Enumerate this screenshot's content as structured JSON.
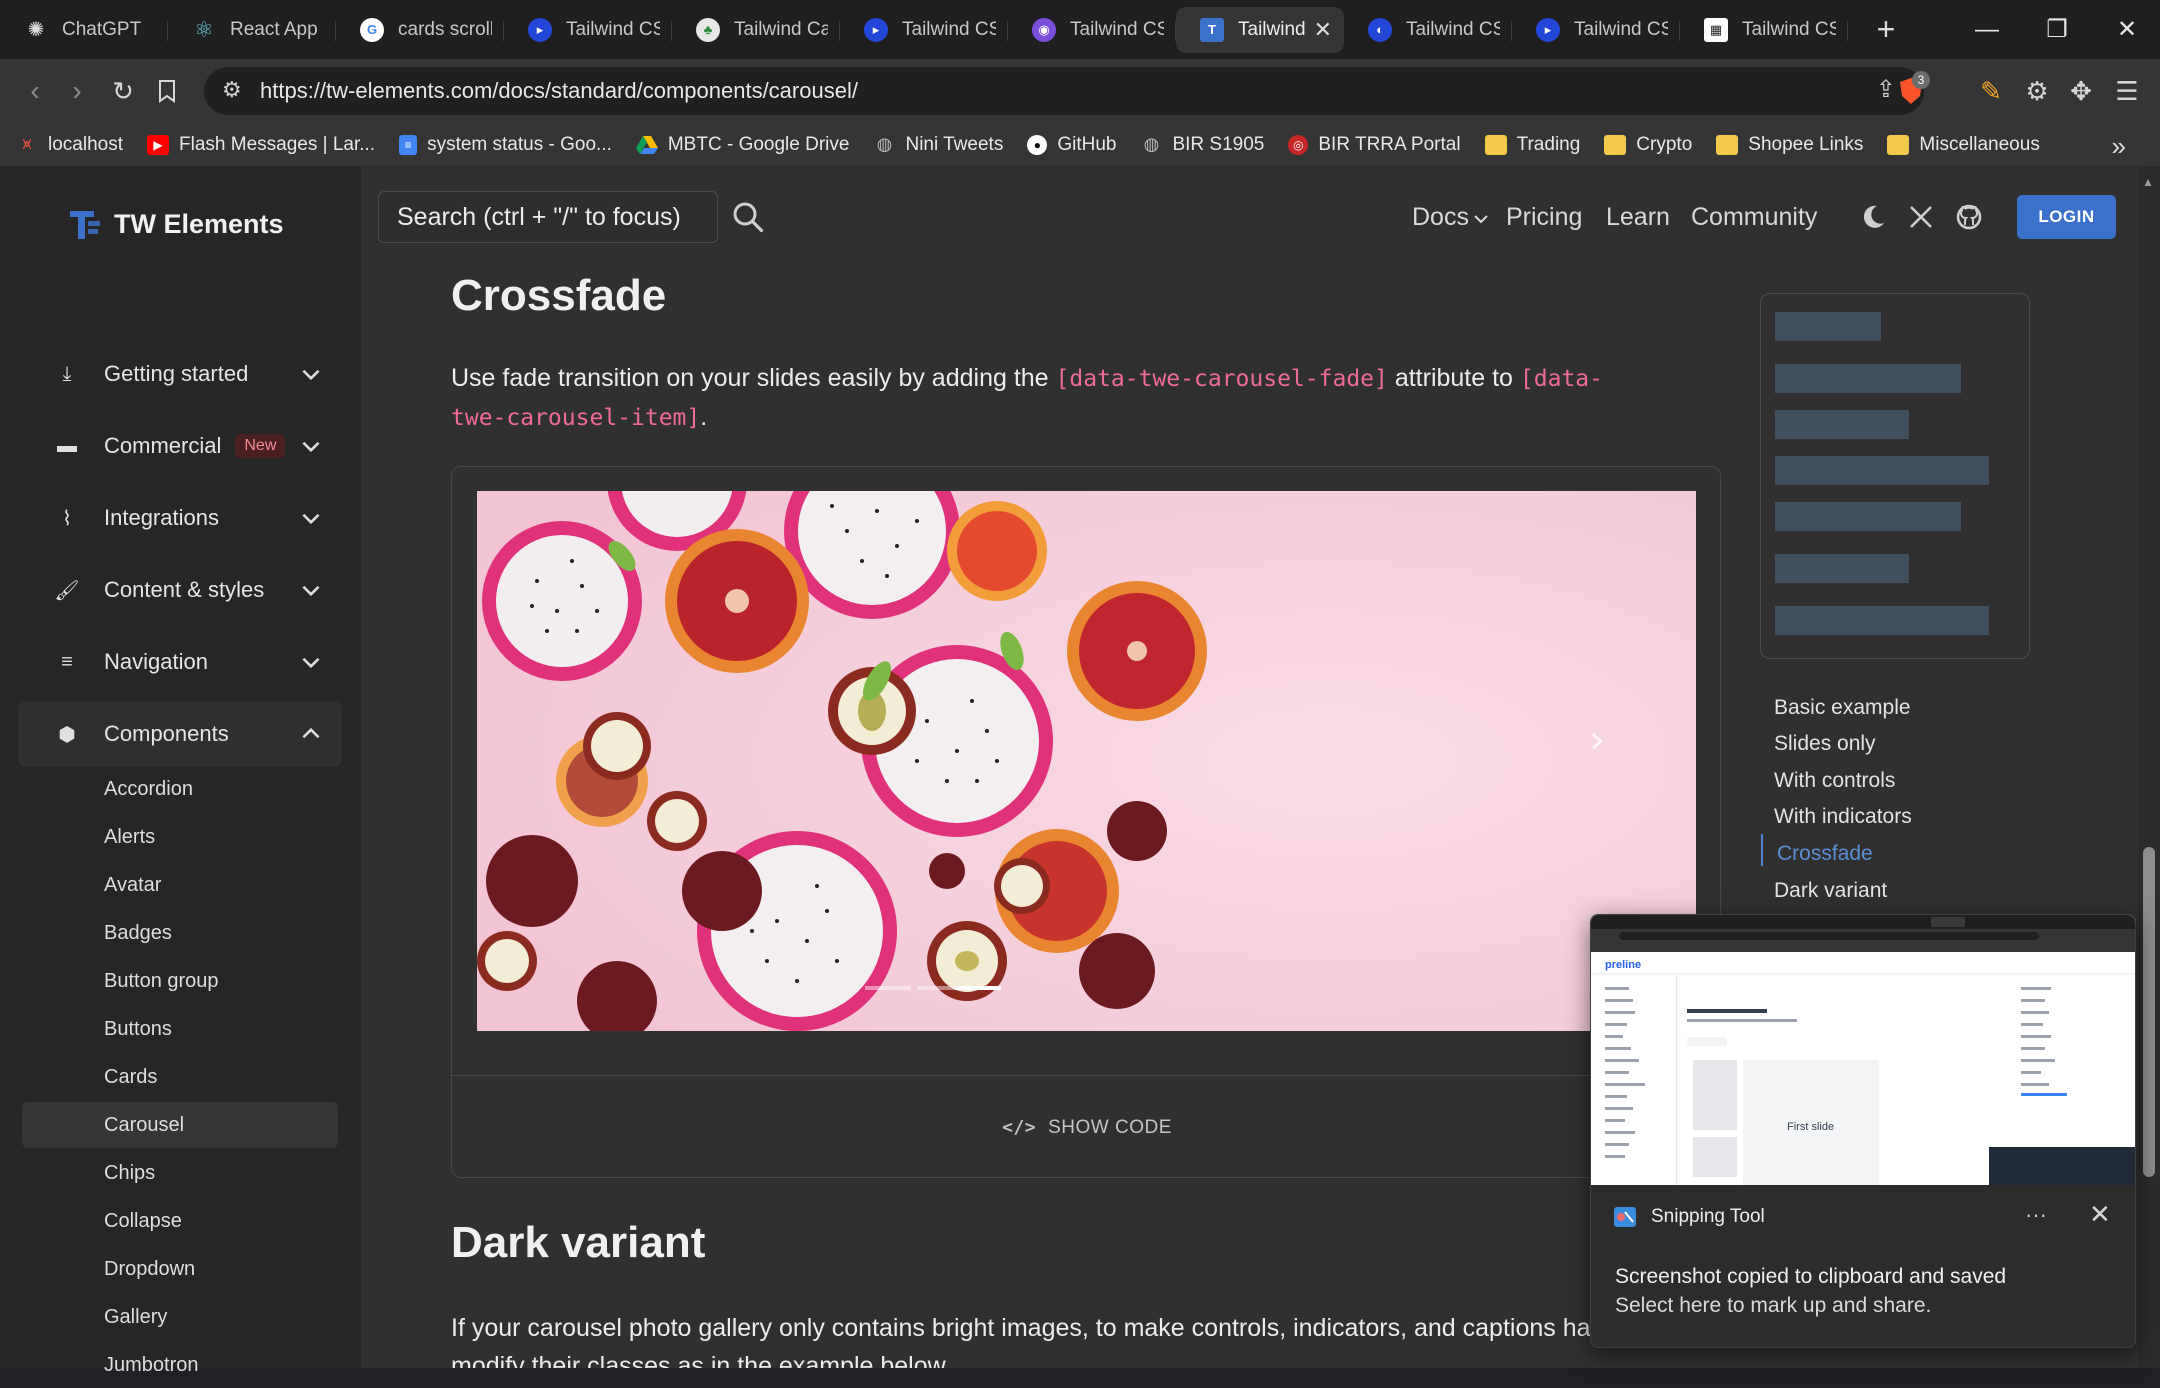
{
  "browser": {
    "tabs": [
      {
        "title": "ChatGPT",
        "icon": "chatgpt-icon"
      },
      {
        "title": "React App",
        "icon": "react-icon"
      },
      {
        "title": "cards scroll",
        "icon": "google-icon"
      },
      {
        "title": "Tailwind CS",
        "icon": "tailwind-icon"
      },
      {
        "title": "Tailwind Car",
        "icon": "leaf-icon"
      },
      {
        "title": "Tailwind CS",
        "icon": "tailwind-icon"
      },
      {
        "title": "Tailwind CS",
        "icon": "purple-icon"
      },
      {
        "title": "Tailwind",
        "icon": "tw-elements-icon",
        "active": true
      },
      {
        "title": "Tailwind CS",
        "icon": "tailwind-icon"
      },
      {
        "title": "Tailwind CS",
        "icon": "tailwind-icon"
      },
      {
        "title": "Tailwind CS",
        "icon": "grid-icon"
      }
    ],
    "new_tab_label": "+",
    "url": "https://tw-elements.com/docs/standard/components/carousel/",
    "shield_count": "3",
    "bookmarks": [
      {
        "label": "localhost",
        "icon": "laravel-icon"
      },
      {
        "label": "Flash Messages | Lar...",
        "icon": "youtube-icon"
      },
      {
        "label": "system status - Goo...",
        "icon": "docs-icon"
      },
      {
        "label": "MBTC - Google Drive",
        "icon": "drive-icon"
      },
      {
        "label": "Nini Tweets",
        "icon": "globe-icon"
      },
      {
        "label": "GitHub",
        "icon": "github-icon"
      },
      {
        "label": "BIR S1905",
        "icon": "globe-icon"
      },
      {
        "label": "BIR TRRA Portal",
        "icon": "bir-icon"
      },
      {
        "label": "Trading",
        "icon": "folder-icon"
      },
      {
        "label": "Crypto",
        "icon": "folder-icon"
      },
      {
        "label": "Shopee Links",
        "icon": "folder-icon"
      },
      {
        "label": "Miscellaneous",
        "icon": "folder-icon"
      }
    ]
  },
  "site": {
    "brand": "TW Elements",
    "search_placeholder": "Search (ctrl + \"/\" to focus)",
    "nav": {
      "docs": "Docs",
      "pricing": "Pricing",
      "learn": "Learn",
      "community": "Community",
      "login": "LOGIN"
    }
  },
  "sidebar": {
    "sections": [
      {
        "label": "Getting started",
        "icon": "download-icon"
      },
      {
        "label": "Commercial",
        "icon": "folder-icon",
        "badge": "New"
      },
      {
        "label": "Integrations",
        "icon": "paperclip-icon"
      },
      {
        "label": "Content & styles",
        "icon": "brush-icon"
      },
      {
        "label": "Navigation",
        "icon": "menu-icon"
      },
      {
        "label": "Components",
        "icon": "cube-icon",
        "expanded": true
      }
    ],
    "components": [
      "Accordion",
      "Alerts",
      "Avatar",
      "Badges",
      "Button group",
      "Buttons",
      "Cards",
      "Carousel",
      "Chips",
      "Collapse",
      "Dropdown",
      "Gallery",
      "Jumbotron"
    ],
    "selected": "Carousel"
  },
  "main": {
    "crossfade_heading": "Crossfade",
    "intro_1": "Use fade transition on your slides easily by adding the ",
    "code_1": "[data-twe-carousel-fade]",
    "intro_2": " attribute to ",
    "code_2": "[data-twe-carousel-item]",
    "intro_3": ".",
    "show_code": "SHOW CODE",
    "carousel_indicators": 3,
    "carousel_active_indicator": 3,
    "dark_heading": "Dark variant",
    "dark_text": "If your carousel photo gallery only contains bright images, to make controls, indicators, and captions have m contrast, modify their classes as in the example below."
  },
  "toc": {
    "items": [
      "Basic example",
      "Slides only",
      "With controls",
      "With indicators",
      "Crossfade",
      "Dark variant"
    ],
    "active": "Crossfade"
  },
  "toast": {
    "app": "Snipping Tool",
    "line1": "Screenshot copied to clipboard and saved",
    "line2": "Select here to mark up and share.",
    "thumb_brand": "preline",
    "thumb_slide": "First slide"
  },
  "colors": {
    "accent": "#3b71ca",
    "code": "#ef6a95",
    "toc_active": "#5a8fd6",
    "badge_text": "#f28b94"
  }
}
